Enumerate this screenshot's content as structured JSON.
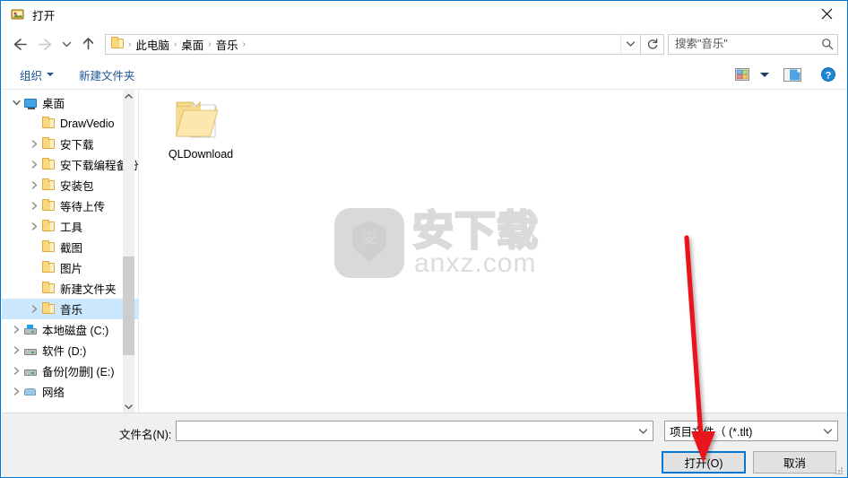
{
  "window": {
    "title": "打开",
    "title_icon": "app-icon",
    "close_label": "✕",
    "accent_color": "#0078d7",
    "selection_color": "#cce8ff"
  },
  "nav": {
    "back_icon": "arrow-left-icon",
    "forward_icon": "arrow-right-icon",
    "recent_icon": "chevron-down-icon",
    "up_icon": "arrow-up-icon",
    "refresh_icon": "refresh-icon",
    "address_dropdown_icon": "chevron-down-icon",
    "breadcrumb": [
      "此电脑",
      "桌面",
      "音乐"
    ],
    "breadcrumb_separator": "›"
  },
  "search": {
    "placeholder": "搜索\"音乐\"",
    "value": "",
    "icon": "search-icon"
  },
  "toolbar": {
    "organize_label": "组织",
    "new_folder_label": "新建文件夹",
    "view_icon": "view-tiles-icon",
    "view_caret_icon": "chevron-down-icon",
    "preview_pane_icon": "preview-pane-icon",
    "help_icon": "help-question-icon"
  },
  "sidebar": {
    "items": [
      {
        "label": "桌面",
        "icon": "desktop-icon",
        "indent": 0,
        "expander": "expanded",
        "selected": false
      },
      {
        "label": "DrawVedio",
        "icon": "folder-icon",
        "indent": 1,
        "expander": "none",
        "selected": false
      },
      {
        "label": "安下载",
        "icon": "folder-icon",
        "indent": 1,
        "expander": "collapsed",
        "selected": false
      },
      {
        "label": "安下载编程备份",
        "icon": "folder-icon",
        "indent": 1,
        "expander": "collapsed",
        "selected": false
      },
      {
        "label": "安装包",
        "icon": "folder-icon",
        "indent": 1,
        "expander": "collapsed",
        "selected": false
      },
      {
        "label": "等待上传",
        "icon": "folder-icon",
        "indent": 1,
        "expander": "collapsed",
        "selected": false
      },
      {
        "label": "工具",
        "icon": "folder-icon",
        "indent": 1,
        "expander": "collapsed",
        "selected": false
      },
      {
        "label": "截图",
        "icon": "folder-icon",
        "indent": 1,
        "expander": "none",
        "selected": false
      },
      {
        "label": "图片",
        "icon": "folder-icon",
        "indent": 1,
        "expander": "none",
        "selected": false
      },
      {
        "label": "新建文件夹",
        "icon": "folder-icon",
        "indent": 1,
        "expander": "none",
        "selected": false
      },
      {
        "label": "音乐",
        "icon": "folder-icon",
        "indent": 1,
        "expander": "collapsed",
        "selected": true
      },
      {
        "label": "本地磁盘 (C:)",
        "icon": "drive-windows-icon",
        "indent": 0,
        "expander": "collapsed",
        "selected": false
      },
      {
        "label": "软件 (D:)",
        "icon": "drive-icon",
        "indent": 0,
        "expander": "collapsed",
        "selected": false
      },
      {
        "label": "备份[勿删] (E:)",
        "icon": "drive-icon",
        "indent": 0,
        "expander": "collapsed",
        "selected": false
      },
      {
        "label": "网络",
        "icon": "network-icon",
        "indent": 0,
        "expander": "collapsed",
        "selected": false
      }
    ],
    "scrollbar": {
      "up_icon": "chevron-up-icon",
      "down_icon": "chevron-down-icon"
    }
  },
  "files": {
    "items": [
      {
        "name": "QLDownload",
        "icon": "folder-with-document-icon"
      }
    ]
  },
  "watermark": {
    "shield_text": "安",
    "brand": "安下载",
    "domain": "anxz.com"
  },
  "bottom": {
    "filename_label": "文件名(N):",
    "filename_value": "",
    "filename_caret_icon": "chevron-down-icon",
    "filetype_value": "项目文件（ (*.tlt)",
    "filetype_caret_icon": "chevron-down-icon",
    "open_label": "打开(O)",
    "cancel_label": "取消",
    "resize_grip_icon": "resize-grip-icon"
  },
  "annotation": {
    "arrow_color": "#e8151b",
    "arrow_points_to": "打开(O)"
  }
}
